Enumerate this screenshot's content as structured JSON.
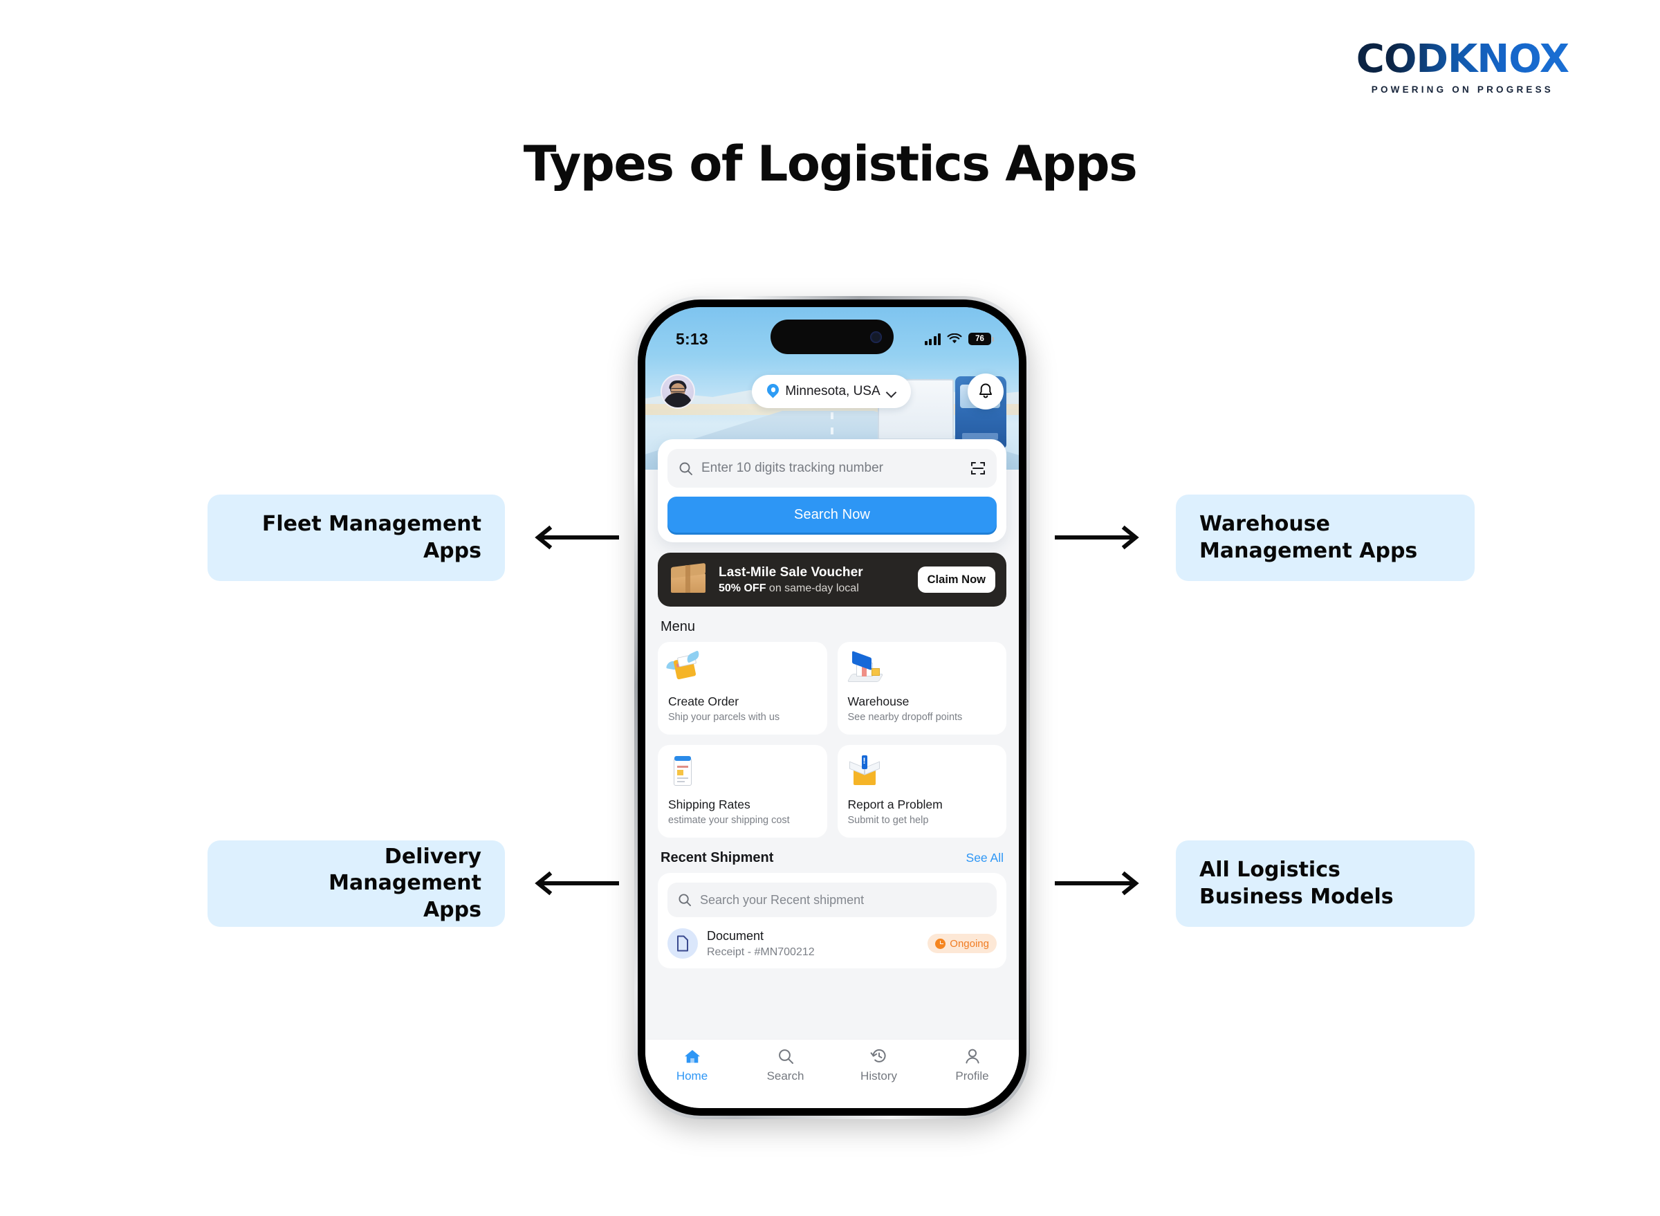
{
  "brand": {
    "name": "CODKNOX",
    "tagline": "POWERING ON PROGRESS"
  },
  "page": {
    "title": "Types of Logistics Apps"
  },
  "labels": {
    "fleet": "Fleet Management\nApps",
    "delivery": "Delivery Management\nApps",
    "warehouse": "Warehouse\nManagement Apps",
    "models": "All Logistics\nBusiness Models"
  },
  "colors": {
    "label_bg": "#ddf0fe",
    "accent_blue": "#2d96f5",
    "badge_orange": "#f07c23",
    "dark_banner": "#272523"
  },
  "phone": {
    "status": {
      "time": "5:13",
      "battery": "76"
    },
    "header": {
      "location": "Minnesota, USA"
    },
    "search": {
      "placeholder": "Enter 10 digits tracking number",
      "button": "Search Now"
    },
    "voucher": {
      "title": "Last-Mile Sale Voucher",
      "discount": "50% OFF",
      "subtitle": " on same-day local",
      "cta": "Claim Now"
    },
    "menu": {
      "heading": "Menu",
      "items": [
        {
          "name": "Create Order",
          "desc": "Ship your parcels with us",
          "icon": "winged-parcel-icon"
        },
        {
          "name": "Warehouse",
          "desc": "See nearby dropoff points",
          "icon": "warehouse-building-icon"
        },
        {
          "name": "Shipping Rates",
          "desc": "estimate your shipping cost",
          "icon": "clipboard-invoice-icon"
        },
        {
          "name": "Report a Problem",
          "desc": "Submit to get help",
          "icon": "open-box-alert-icon"
        }
      ]
    },
    "recent": {
      "heading": "Recent Shipment",
      "see_all": "See All",
      "search_placeholder": "Search your Recent shipment",
      "rows": [
        {
          "name": "Document",
          "id": "Receipt - #MN700212",
          "status": "Ongoing"
        }
      ]
    },
    "tabs": [
      {
        "label": "Home",
        "icon": "home-icon",
        "active": true
      },
      {
        "label": "Search",
        "icon": "search-icon",
        "active": false
      },
      {
        "label": "History",
        "icon": "history-icon",
        "active": false
      },
      {
        "label": "Profile",
        "icon": "profile-icon",
        "active": false
      }
    ]
  }
}
